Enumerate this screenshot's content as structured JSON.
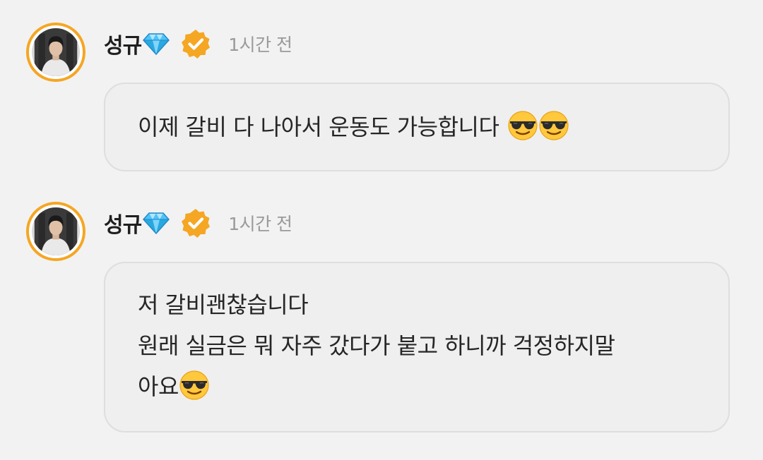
{
  "messages": [
    {
      "author": "성규",
      "timestamp": "1시간 전",
      "lines": [
        "이제 갈비 다 나아서 운동도 가능합니다"
      ],
      "emojis": [
        "sunglasses-emoji",
        "sunglasses-emoji"
      ]
    },
    {
      "author": "성규",
      "timestamp": "1시간 전",
      "lines": [
        "저 갈비괜찮습니다",
        "원래 실금은 뭐 자주 갔다가 붙고 하니까 걱정하지말",
        "아요"
      ],
      "emojis": [
        "sunglasses-emoji"
      ]
    }
  ],
  "icons": {
    "badge": "diamond-icon",
    "verified": "verified-badge-icon"
  },
  "colors": {
    "background": "#f2f2f2",
    "bubble": "#efefef",
    "bubble_border": "#dedede",
    "avatar_ring": "#f5a623",
    "verified": "#f5a623",
    "diamond": "#4fc3f7",
    "timestamp": "#9a9a9a"
  }
}
